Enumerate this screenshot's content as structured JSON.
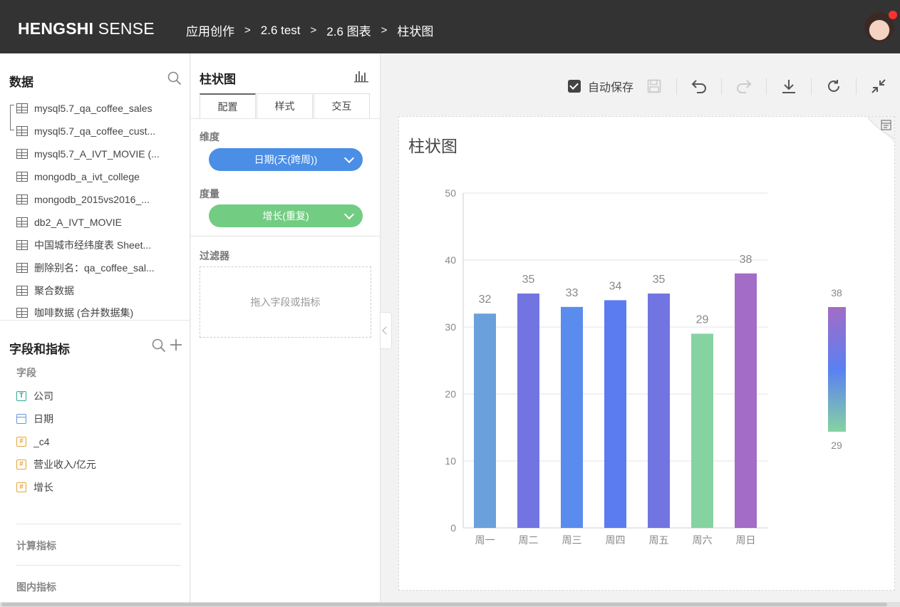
{
  "header": {
    "logo_bold": "HENGSHI",
    "logo_light": " SENSE",
    "breadcrumb": [
      "应用创作",
      "2.6 test",
      "2.6 图表",
      "柱状图"
    ],
    "breadcrumb_sep": ">"
  },
  "left": {
    "data_title": "数据",
    "datasets": [
      "mysql5.7_qa_coffee_sales",
      "mysql5.7_qa_coffee_cust...",
      "mysql5.7_A_IVT_MOVIE (...",
      "mongodb_a_ivt_college",
      "mongodb_2015vs2016_...",
      "db2_A_IVT_MOVIE",
      "中国城市经纬度表 Sheet...",
      "删除别名：qa_coffee_sal...",
      "聚合数据",
      "咖啡数据 (合并数据集)"
    ],
    "fields_title": "字段和指标",
    "fields_sub": "字段",
    "fields": [
      {
        "icon": "T",
        "label": "公司"
      },
      {
        "icon": "",
        "label": "日期"
      },
      {
        "icon": "#",
        "label": "_c4"
      },
      {
        "icon": "#",
        "label": "营业收入/亿元"
      },
      {
        "icon": "#",
        "label": "增长"
      }
    ],
    "calc_metrics": "计算指标",
    "chart_metrics": "图内指标"
  },
  "mid": {
    "title": "柱状图",
    "tabs": [
      "配置",
      "样式",
      "交互"
    ],
    "dimension_label": "维度",
    "dimension_value": "日期(天(跨周))",
    "dimension_color": "#4a8ee6",
    "measure_label": "度量",
    "measure_value": "增长(重复)",
    "measure_color": "#72cc82",
    "filter_label": "过滤器",
    "filter_placeholder": "拖入字段或指标"
  },
  "toolbar": {
    "autosave_label": "自动保存",
    "autosave_checked": true
  },
  "chart_data": {
    "type": "bar",
    "title": "柱状图",
    "categories": [
      "周一",
      "周二",
      "周三",
      "周四",
      "周五",
      "周六",
      "周日"
    ],
    "values": [
      32,
      35,
      33,
      34,
      35,
      29,
      38
    ],
    "colors": [
      "#6aa0dc",
      "#7274e2",
      "#5a8cee",
      "#5a7cf0",
      "#7274e2",
      "#86d3a2",
      "#a36cc6"
    ],
    "ylim": [
      0,
      50
    ],
    "yticks": [
      0,
      10,
      20,
      30,
      40,
      50
    ],
    "grid": true,
    "legend": {
      "type": "visualMap",
      "max_label": "38",
      "min_label": "29",
      "colors": [
        "#a36cc6",
        "#5a80f2",
        "#86d3a2"
      ]
    }
  }
}
